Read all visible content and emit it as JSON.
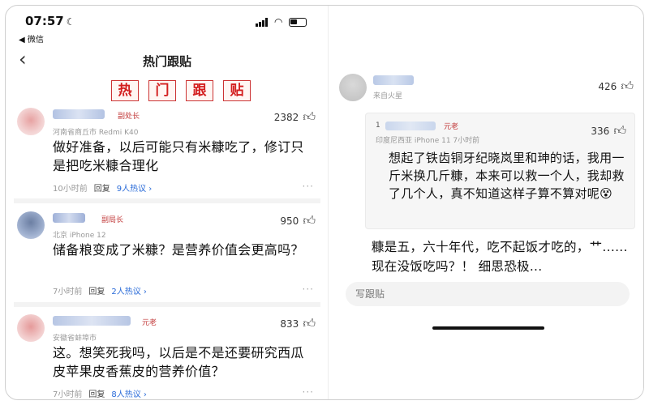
{
  "status_bar": {
    "time": "07:57",
    "back_app": "◀ 微信"
  },
  "nav": {
    "title": "热门跟贴"
  },
  "banner": [
    "热",
    "门",
    "跟",
    "贴"
  ],
  "comments": [
    {
      "badge": "副处长",
      "likes": "2382",
      "meta": "河南省商丘市  Redmi K40",
      "text": "做好准备，以后可能只有米糠吃了，修订只是把吃米糠合理化",
      "time": "10小时前",
      "reply": "回复",
      "hot": "9人热议 ›"
    },
    {
      "badge": "副局长",
      "likes": "950",
      "meta": "北京  iPhone 12",
      "text": "储备粮变成了米糠？是营养价值会更高吗？",
      "time": "7小时前",
      "reply": "回复",
      "hot": "2人热议 ›"
    },
    {
      "badge": "元老",
      "likes": "833",
      "meta": "安徽省蚌埠市",
      "text": "这。想笑死我吗，以后是不是还要研究西瓜皮苹果皮香蕉皮的营养价值？",
      "time": "7小时前",
      "reply": "回复",
      "hot": "8人热议 ›"
    }
  ],
  "right": {
    "meta": "来自火星",
    "likes": "426",
    "quote": {
      "num": "1",
      "badge": "元老",
      "meta": "印度尼西亚  iPhone 11  7小时前",
      "likes": "336",
      "text": "想起了铁齿铜牙纪晓岚里和珅的话，我用一斤米换几斤糠，本来可以救一个人，我却救了几个人，真不知道这样子算不算对呢😵"
    },
    "text": "糠是五，六十年代，吃不起饭才吃的，艹......现在没饭吃吗？！ 细思恐极...",
    "input_placeholder": "写跟贴"
  },
  "icons": {
    "thumb": "thumbs-up-icon",
    "more": "more-dots-icon",
    "back": "back-chevron-icon",
    "signal": "signal-icon",
    "wifi": "wifi-icon",
    "battery": "battery-icon"
  },
  "colors": {
    "badge_red": "#c23a3a",
    "hot_blue": "#2a6bd8",
    "banner_red": "#d31f1f"
  }
}
